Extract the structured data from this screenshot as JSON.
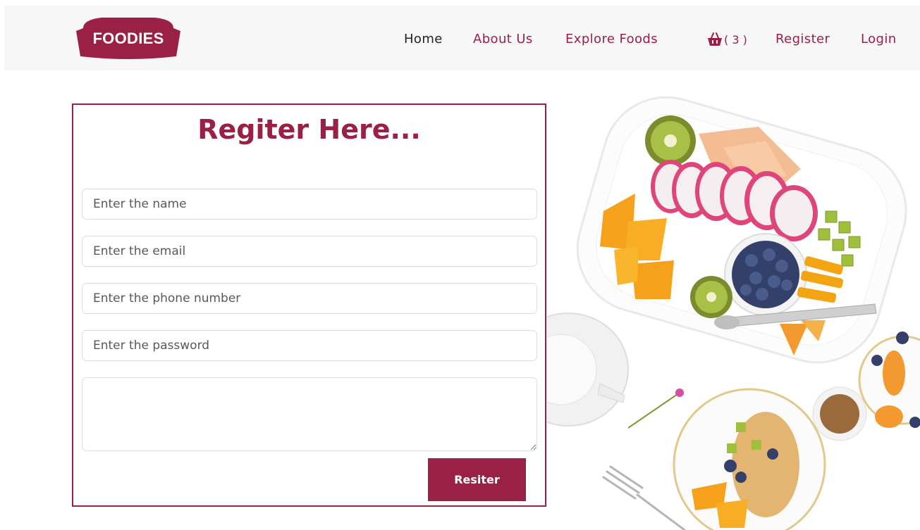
{
  "brand": {
    "logo_text": "FOODIES",
    "color": "#9b2045"
  },
  "nav": {
    "home": "Home",
    "about": "About Us",
    "explore": "Explore Foods",
    "cart_count": "( 3 )",
    "register": "Register",
    "login": "Login"
  },
  "form": {
    "title": "Regiter Here...",
    "name_placeholder": "Enter the name",
    "email_placeholder": "Enter the email",
    "phone_placeholder": "Enter the phone number",
    "password_placeholder": "Enter the password",
    "message_value": "",
    "submit_label": "Resiter"
  },
  "icons": {
    "cart": "basket-icon"
  }
}
